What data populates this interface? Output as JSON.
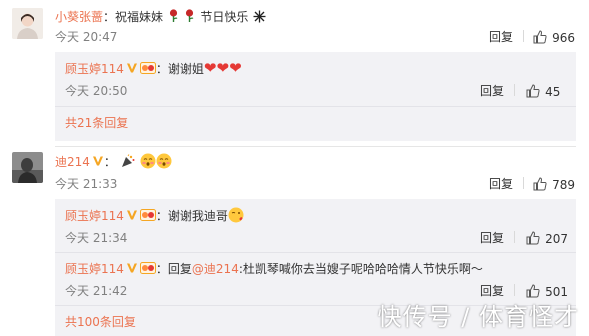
{
  "comments": [
    {
      "author": "小葵张蔷",
      "text_prefix": "：祝福妹妹",
      "text_suffix": "节日快乐",
      "time": "今天 20:47",
      "reply_label": "回复",
      "likes": "966",
      "replies": [
        {
          "author": "顾玉婷114",
          "text_prefix": "：谢谢姐",
          "time": "今天 20:50",
          "reply_label": "回复",
          "likes": "45"
        }
      ],
      "more_replies": "共21条回复"
    },
    {
      "author": "迪214",
      "text_prefix": "：",
      "time": "今天 21:33",
      "reply_label": "回复",
      "likes": "789",
      "replies": [
        {
          "author": "顾玉婷114",
          "text_prefix": "：谢谢我迪哥",
          "time": "今天 21:34",
          "reply_label": "回复",
          "likes": "207"
        },
        {
          "author": "顾玉婷114",
          "text_prefix": "：回复",
          "mention": "@迪214",
          "text_suffix": ":杜凯琴喊你去当嫂子呢哈哈哈情人节快乐啊～",
          "time": "今天 21:42",
          "reply_label": "回复",
          "likes": "501"
        }
      ],
      "more_replies": "共100条回复"
    }
  ],
  "watermark": "快传号 / 体育怪才",
  "colors": {
    "username": "#eb7350",
    "verified_badge": "#f5a623",
    "reply_bg": "#f2f2f5",
    "time": "#808080"
  },
  "icons": [
    "thumbs-up-icon",
    "rose-icon",
    "firework-icon",
    "heart-icon",
    "party-popper-icon",
    "blush-emoji-icon",
    "kiss-emoji-icon",
    "verified-v-icon",
    "level-badge-icon"
  ]
}
